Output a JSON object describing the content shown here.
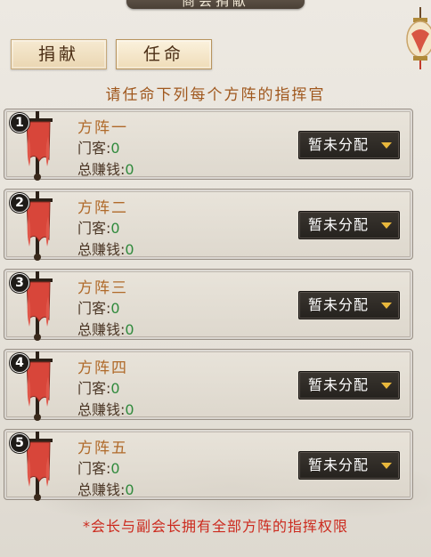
{
  "header": {
    "title": "商会捐献"
  },
  "tabs": [
    {
      "label": "捐献"
    },
    {
      "label": "任命"
    }
  ],
  "hint": "请任命下列每个方阵的指挥官",
  "stat_labels": {
    "members": "门客:",
    "earnings": "总赚钱:"
  },
  "formations": [
    {
      "badge": "1",
      "name": "方阵一",
      "members": "0",
      "earnings": "0",
      "assign_label": "暂未分配"
    },
    {
      "badge": "2",
      "name": "方阵二",
      "members": "0",
      "earnings": "0",
      "assign_label": "暂未分配"
    },
    {
      "badge": "3",
      "name": "方阵三",
      "members": "0",
      "earnings": "0",
      "assign_label": "暂未分配"
    },
    {
      "badge": "4",
      "name": "方阵四",
      "members": "0",
      "earnings": "0",
      "assign_label": "暂未分配"
    },
    {
      "badge": "5",
      "name": "方阵五",
      "members": "0",
      "earnings": "0",
      "assign_label": "暂未分配"
    }
  ],
  "footnote": "*会长与副会长拥有全部方阵的指挥权限",
  "colors": {
    "name": "#b06a2a",
    "value": "#2f8a3c",
    "footnote": "#cc2a1e",
    "flag": "#d8463a",
    "caret": "#e8b73c"
  },
  "icons": {
    "flag": "war-banner-icon",
    "caret": "caret-down-icon",
    "lantern": "lantern-icon"
  }
}
